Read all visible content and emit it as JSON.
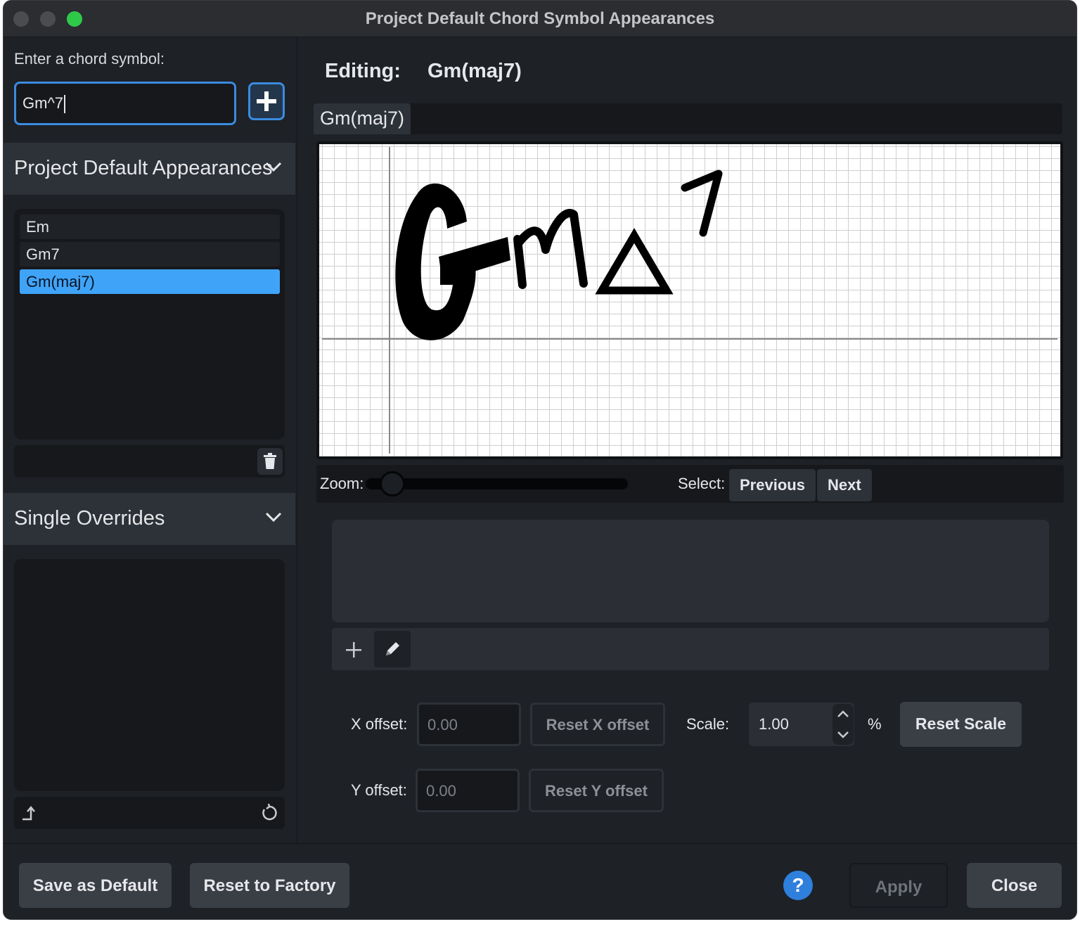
{
  "window": {
    "title": "Project Default Chord Symbol Appearances"
  },
  "left": {
    "enter_label": "Enter a chord symbol:",
    "input_value": "Gm^7",
    "project_defaults": {
      "label": "Project Default Appearances",
      "items": [
        "Em",
        "Gm7",
        "Gm(maj7)"
      ],
      "selected_index": 2
    },
    "single_overrides": {
      "label": "Single Overrides"
    }
  },
  "right": {
    "editing_label": "Editing:",
    "editing_value": "Gm(maj7)",
    "tab_label": "Gm(maj7)",
    "zoom_label": "Zoom:",
    "zoom_level": 0.1,
    "select_label": "Select:",
    "previous_label": "Previous",
    "next_label": "Next",
    "x_offset_label": "X offset:",
    "x_offset_value": "0.00",
    "reset_x_label": "Reset X offset",
    "y_offset_label": "Y offset:",
    "y_offset_value": "0.00",
    "reset_y_label": "Reset Y offset",
    "scale_label": "Scale:",
    "scale_value": "1.00",
    "percent": "%",
    "reset_scale_label": "Reset Scale"
  },
  "bottom": {
    "save_default_label": "Save as Default",
    "reset_factory_label": "Reset to Factory",
    "help_label": "?",
    "apply_label": "Apply",
    "close_label": "Close"
  },
  "colors": {
    "accent": "#3a8be0",
    "selection": "#3fa4f8",
    "window_bg": "#1e2126",
    "maximize": "#2fc94a"
  },
  "icons": [
    "plus-icon",
    "chevron-down-icon",
    "trash-icon",
    "export-icon",
    "revert-icon",
    "pencil-icon",
    "question-icon"
  ]
}
